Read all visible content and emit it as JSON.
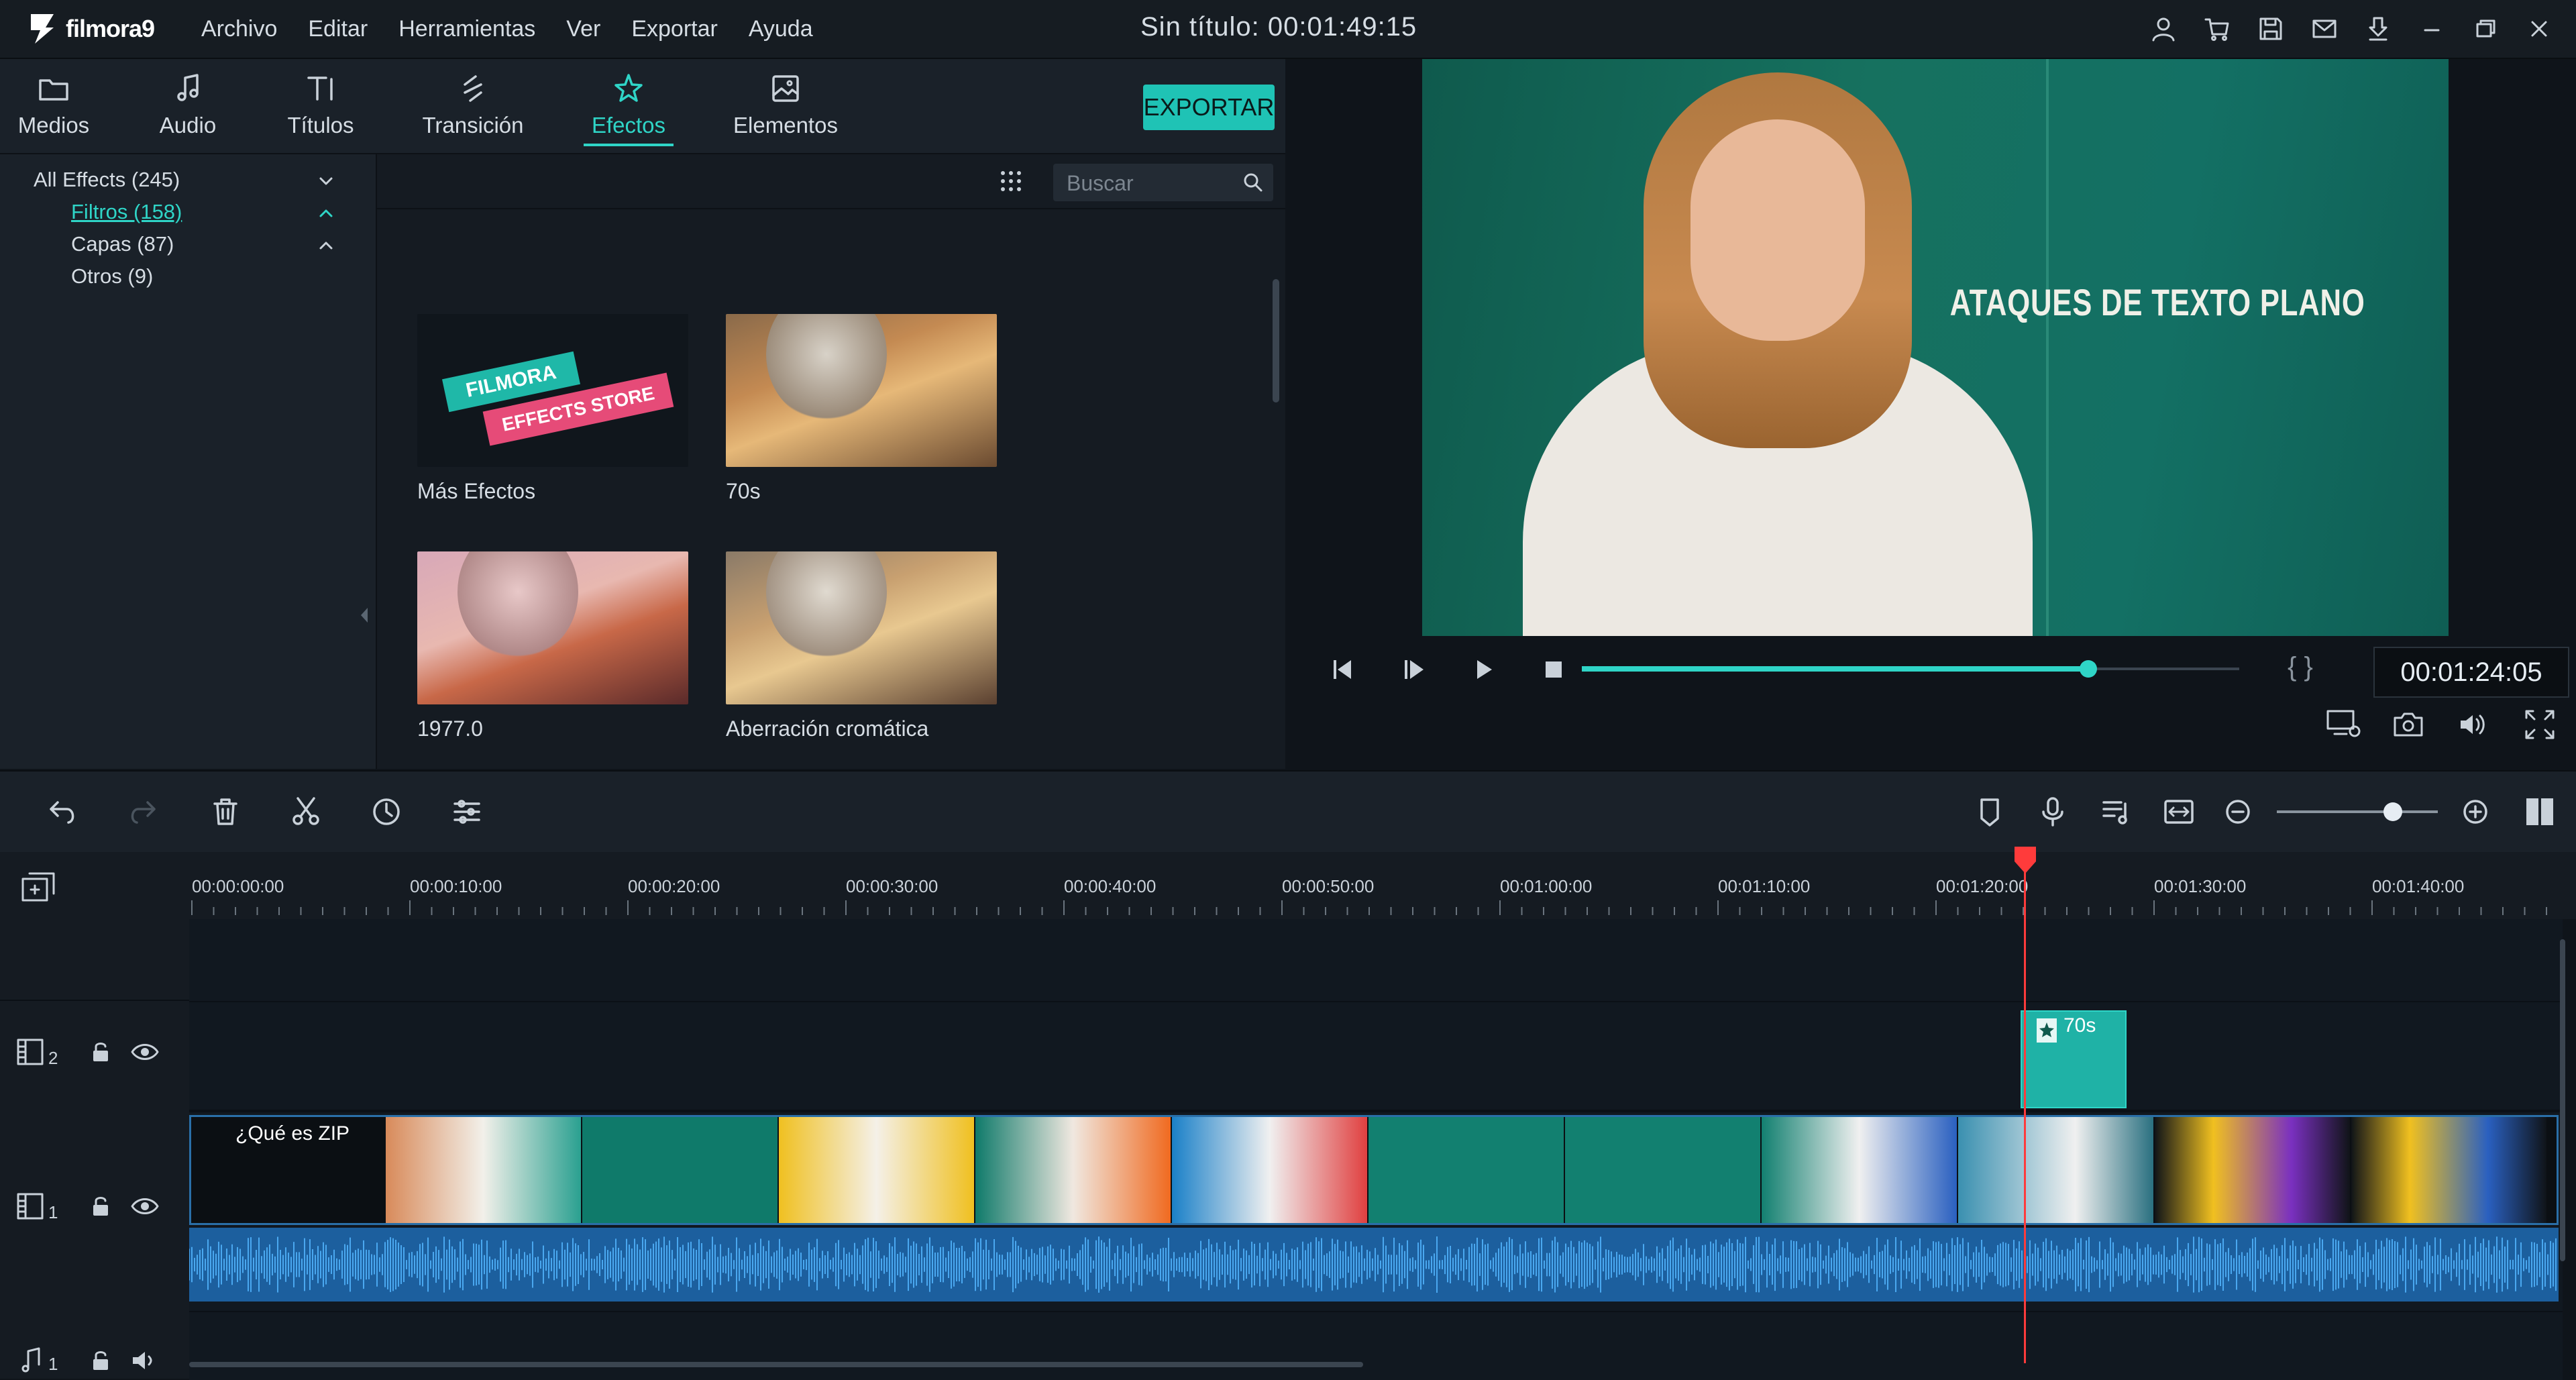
{
  "app": {
    "logo": "filmora9",
    "document_title": "Sin título:  00:01:49:15",
    "menu": [
      "Archivo",
      "Editar",
      "Herramientas",
      "Ver",
      "Exportar",
      "Ayuda"
    ]
  },
  "library": {
    "tabs": [
      {
        "label": "Medios",
        "icon": "folder-icon"
      },
      {
        "label": "Audio",
        "icon": "music-note-icon"
      },
      {
        "label": "Títulos",
        "icon": "text-icon"
      },
      {
        "label": "Transición",
        "icon": "transition-icon"
      },
      {
        "label": "Efectos",
        "icon": "effects-icon",
        "active": true
      },
      {
        "label": "Elementos",
        "icon": "image-icon"
      }
    ],
    "export_label": "EXPORTAR",
    "tree": [
      {
        "label": "All Effects (245)"
      },
      {
        "label": "Filtros (158)",
        "active": true
      },
      {
        "label": "Capas (87)"
      },
      {
        "label": "Otros (9)"
      }
    ],
    "search_placeholder": "Buscar",
    "effects": [
      {
        "label": "Más Efectos"
      },
      {
        "label": "70s"
      },
      {
        "label": "1977.0"
      },
      {
        "label": "Aberración cromática"
      }
    ],
    "store_banner": {
      "line1": "FILMORA",
      "line2": "EFFECTS STORE"
    }
  },
  "preview": {
    "caption": "ATAQUES DE TEXTO PLANO",
    "timecode": "00:01:24:05",
    "progress": 0.77,
    "brackets": "{ }"
  },
  "timeline": {
    "ruler_labels": [
      "00:00:00:00",
      "00:00:10:00",
      "00:00:20:00",
      "00:00:30:00",
      "00:00:40:00",
      "00:00:50:00",
      "00:01:00:00",
      "00:01:10:00",
      "00:01:20:00",
      "00:01:30:00",
      "00:01:40:00"
    ],
    "tracks": [
      {
        "number": "2"
      },
      {
        "number": "1"
      },
      {
        "number": "1"
      }
    ],
    "main_clip_title": "¿Qué es ZIP",
    "effect_clip_label": "70s",
    "zoom": 0.72
  },
  "colors": {
    "accent": "#2fd5c7",
    "playhead": "#ff3b3b",
    "audio": "#1c5f9e"
  }
}
